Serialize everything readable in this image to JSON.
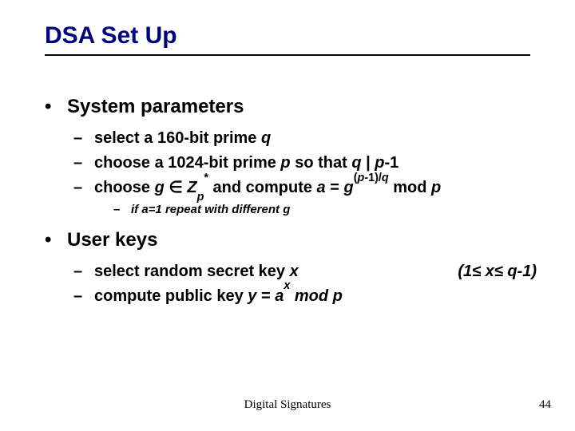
{
  "title": "DSA Set Up",
  "sections": {
    "sys_heading": "System parameters",
    "sys_items": {
      "a_pre": "select a 160-bit prime ",
      "a_var": "q",
      "b_pre": "choose a 1024-bit prime ",
      "b_p": "p",
      "b_mid": " so that ",
      "b_q": "q",
      "b_bar": " | ",
      "b_p2": "p",
      "b_tail": "-1",
      "c_pre": "choose ",
      "c_g": "g",
      "c_in": " ∈ ",
      "c_Z": "Z",
      "c_sub": "p",
      "c_sup": "*",
      "c_and": " and compute ",
      "c_a": "a",
      "c_eq": " = ",
      "c_g2": "g",
      "c_exp_open": "(",
      "c_exp_p": "p",
      "c_exp_mid": "-1)/",
      "c_exp_q": "q",
      "c_mod": " mod ",
      "c_pmod": "p",
      "note": "if a=1 repeat with different g"
    },
    "user_heading": "User keys",
    "user_items": {
      "a_pre": "select random secret key ",
      "a_x": "x",
      "a_rng_open": "(1",
      "a_rng_le1": "≤ ",
      "a_rng_x": "x",
      "a_rng_le2": "≤ ",
      "a_rng_close": "q-1)",
      "b_pre": "compute public key ",
      "b_y": "y",
      "b_eq": " = ",
      "b_a": "a",
      "b_exp": "x",
      "b_mod": " mod ",
      "b_p": "p"
    }
  },
  "footer": {
    "center": "Digital Signatures",
    "page": "44"
  }
}
